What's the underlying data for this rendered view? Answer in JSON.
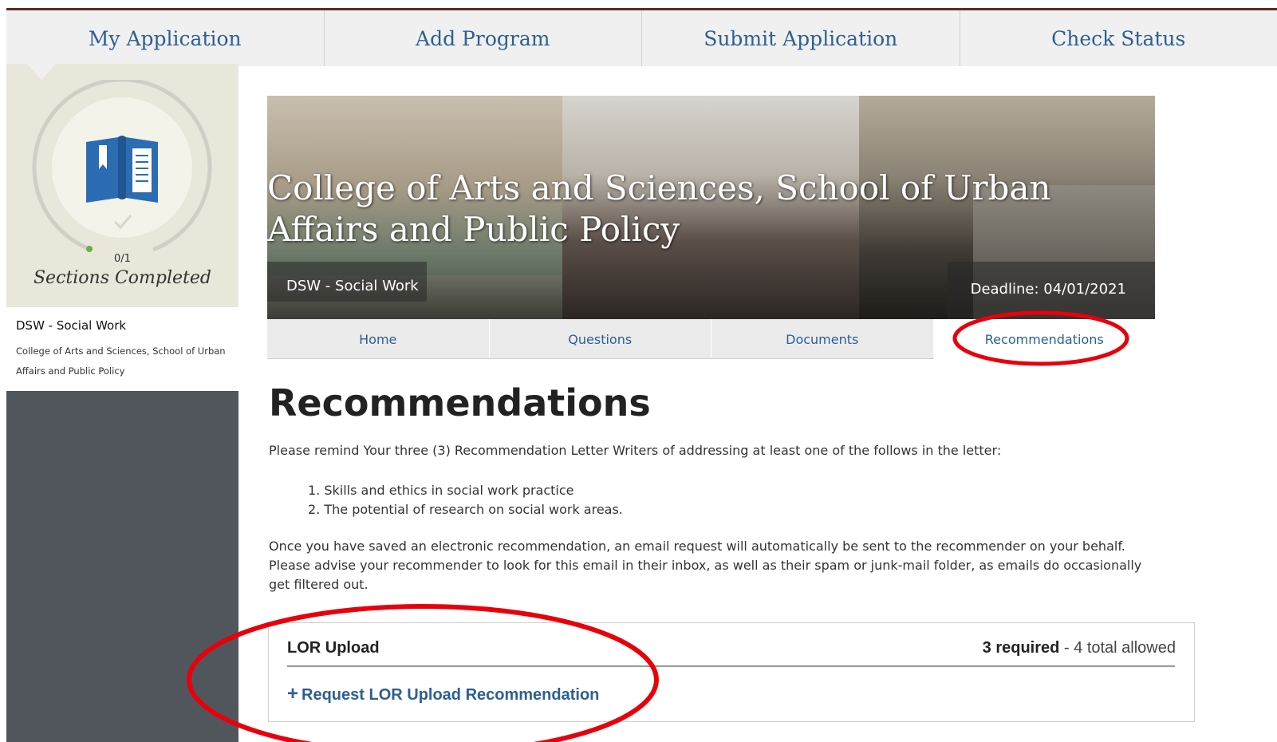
{
  "topnav": {
    "tabs": [
      {
        "label": "My Application"
      },
      {
        "label": "Add Program"
      },
      {
        "label": "Submit Application"
      },
      {
        "label": "Check Status"
      }
    ]
  },
  "sidebar": {
    "progress_count": "0/1",
    "sections_label": "Sections Completed",
    "progress_fraction": 0,
    "icon": "book-icon",
    "program": {
      "title": "DSW - Social Work",
      "subtitle": "College of Arts and Sciences, School of Urban Affairs and Public Policy"
    }
  },
  "banner": {
    "title": "College of Arts and Sciences, School of Urban Affairs and Public Policy",
    "program_label": "DSW - Social Work",
    "deadline": "Deadline: 04/01/2021"
  },
  "subtabs": [
    {
      "label": "Home"
    },
    {
      "label": "Questions"
    },
    {
      "label": "Documents"
    },
    {
      "label": "Recommendations"
    }
  ],
  "content": {
    "title": "Recommendations",
    "intro": "Please remind Your three (3) Recommendation Letter Writers of addressing at least one of the follows in the letter:",
    "list": [
      "1. Skills and ethics in social work practice",
      "2. The potential of research on social work areas."
    ],
    "info": "Once you have saved an electronic recommendation, an email request will automatically be sent to the recommender on your behalf. Please advise your recommender to look for this email in their inbox, as well as their spam or junk-mail folder, as emails do occasionally get filtered out."
  },
  "lor": {
    "title": "LOR Upload",
    "required": "3 required",
    "allowed": " - 4 total allowed",
    "link": "Request LOR Upload Recommendation"
  },
  "colors": {
    "accent": "#2d5f93",
    "annotation": "#e8000b",
    "sidebar_dark": "#51565d",
    "sidebar_light": "#e8e7d9"
  }
}
